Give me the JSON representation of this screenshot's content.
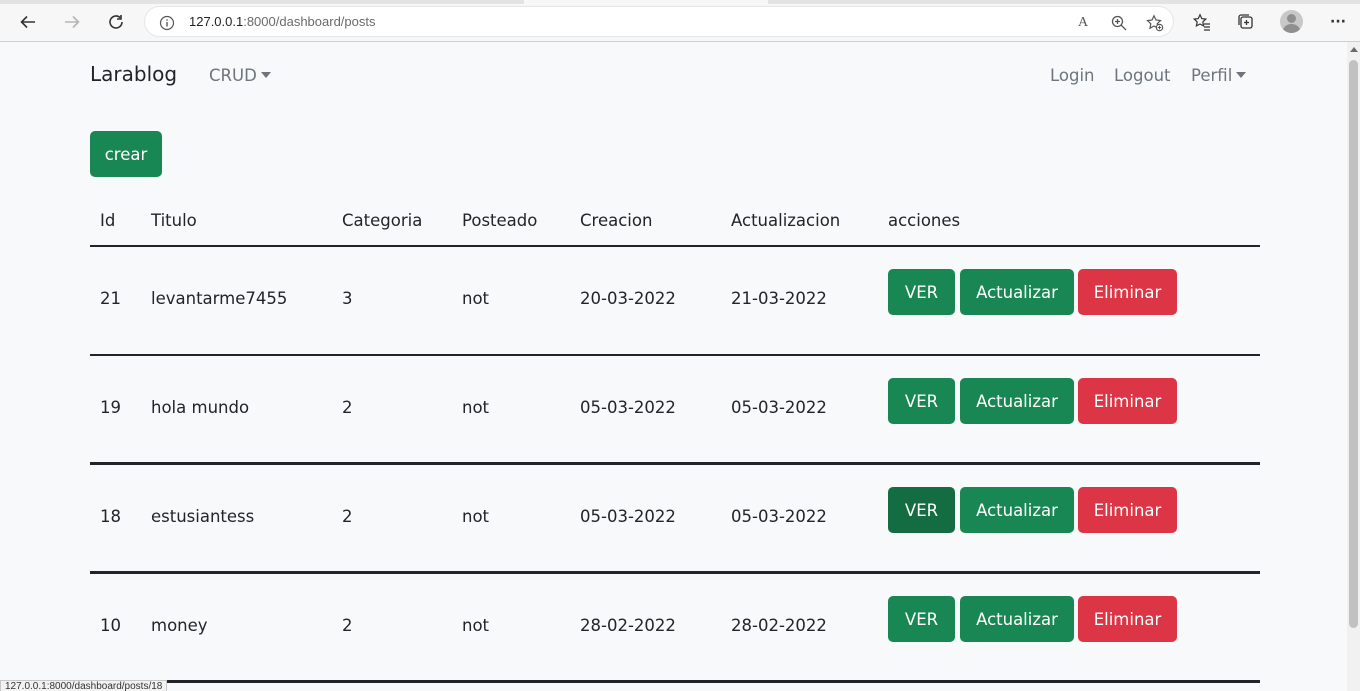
{
  "browser": {
    "url_host": "127.0.0.1",
    "url_rest": ":8000/dashboard/posts",
    "status_url": "127.0.0.1:8000/dashboard/posts/18",
    "read_aloud_label": "A",
    "menu_label": "···"
  },
  "navbar": {
    "brand": "Larablog",
    "crud": "CRUD",
    "login": "Login",
    "logout": "Logout",
    "perfil": "Perfil"
  },
  "create_button": "crear",
  "table": {
    "headers": [
      "Id",
      "Titulo",
      "Categoria",
      "Posteado",
      "Creacion",
      "Actualizacion",
      "acciones"
    ],
    "rows": [
      {
        "id": "21",
        "titulo": "levantarme7455",
        "categoria": "3",
        "posteado": "not",
        "creacion": "20-03-2022",
        "actualizacion": "21-03-2022"
      },
      {
        "id": "19",
        "titulo": "hola mundo",
        "categoria": "2",
        "posteado": "not",
        "creacion": "05-03-2022",
        "actualizacion": "05-03-2022"
      },
      {
        "id": "18",
        "titulo": "estusiantess",
        "categoria": "2",
        "posteado": "not",
        "creacion": "05-03-2022",
        "actualizacion": "05-03-2022"
      },
      {
        "id": "10",
        "titulo": "money",
        "categoria": "2",
        "posteado": "not",
        "creacion": "28-02-2022",
        "actualizacion": "28-02-2022"
      }
    ],
    "actions": {
      "ver": "VER",
      "actualizar": "Actualizar",
      "eliminar": "Eliminar"
    }
  },
  "colors": {
    "success": "#198754",
    "success_hover": "#146c43",
    "danger": "#dc3545",
    "page_bg": "#f8f9fa",
    "muted_link": "#6c757d"
  }
}
